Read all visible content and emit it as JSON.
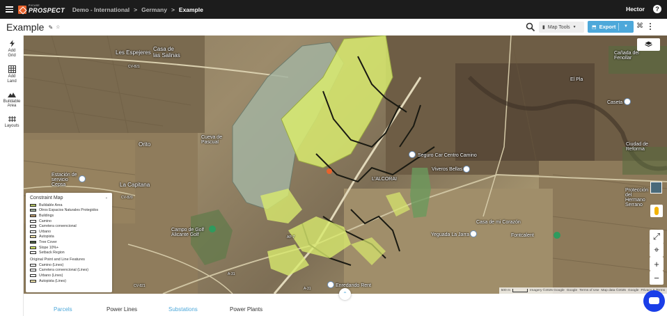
{
  "app": {
    "brand_small": "PVCASE",
    "brand_main": "PROSPECT",
    "breadcrumb": [
      "Demo - International",
      "Germany",
      "Example"
    ],
    "user": "Hector"
  },
  "titlebar": {
    "title": "Example",
    "map_tools_label": "Map Tools",
    "export_label": "Export"
  },
  "sidebar": {
    "items": [
      {
        "label": "Add Grid",
        "icon": "lightning-icon"
      },
      {
        "label": "Add Land",
        "icon": "grid-icon"
      },
      {
        "label": "Buildable Area",
        "icon": "terrain-icon"
      },
      {
        "label": "Layouts",
        "icon": "layouts-icon"
      }
    ]
  },
  "map": {
    "place_labels": [
      "Les Espejeres",
      "Casa de las Salinas",
      "Cueva de Pascual",
      "Orito",
      "La Capitana",
      "Estación de servicio Cepsa",
      "L'ALCORAI",
      "Seguro Car Centro Camino",
      "Viveros Bellas",
      "Cañada del Fenollar",
      "El Pla",
      "Caseta",
      "Campo de Golf Alicante Golf",
      "Casa de mi Corazón",
      "Yeguada La Jarra",
      "Fontcalent",
      "Protección del Hermano Serrano",
      "Enredando Rent",
      "Ciudad de Reforma"
    ],
    "road_labels": [
      "CV-821",
      "CV-820",
      "A-31",
      "AP-7",
      "A-31",
      "CV-821"
    ],
    "attribution": [
      "Imagery ©2025 Google",
      "Google",
      "Terms of Use",
      "Map data ©2025",
      "Google",
      "Privacy & Terms"
    ],
    "scale_label": "500 m"
  },
  "legend": {
    "title": "Constraint Map",
    "items": [
      {
        "label": "Buildable Area",
        "color": "#b5c466"
      },
      {
        "label": "Otros Espacios Naturales Protegidos",
        "color": "#a3b3a0"
      },
      {
        "label": "Buildings",
        "color": "#b89a6e"
      },
      {
        "label": "Camino",
        "color": "#ffffff"
      },
      {
        "label": "Carretera convencional",
        "color": "#ffffff"
      },
      {
        "label": "Urbano",
        "color": "#ffffff"
      },
      {
        "label": "Autopista",
        "color": "#f3e7b0"
      },
      {
        "label": "Tree Cover",
        "color": "#4d5e45"
      },
      {
        "label": "Slope 10%+",
        "color": "#d8ea6e"
      },
      {
        "label": "Setback Region",
        "color": "#ffffff"
      }
    ],
    "subtitle": "Original Point and Line Features",
    "line_items": [
      {
        "label": "Camino (Lines)",
        "color": "#ffffff"
      },
      {
        "label": "Carretera convencional (Lines)",
        "color": "#ffffff"
      },
      {
        "label": "Urbano (Lines)",
        "color": "#ffffff"
      },
      {
        "label": "Autopista (Lines)",
        "color": "#f3e7b0"
      }
    ]
  },
  "bottom_tabs": [
    "Parcels",
    "Power Lines",
    "Substations",
    "Power Plants"
  ],
  "colors": {
    "accent": "#4da8da",
    "active_tab": "#4da8da",
    "topbar": "#1c1c1c",
    "brand": "#e8622c"
  }
}
